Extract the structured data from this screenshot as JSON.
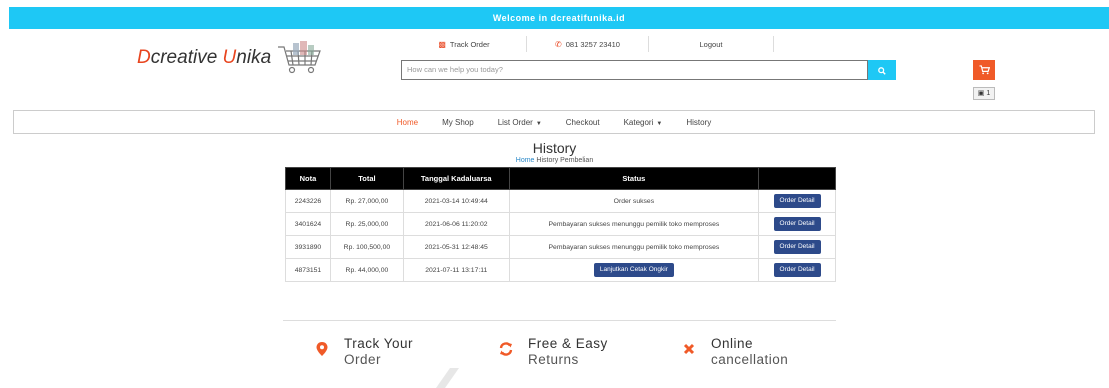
{
  "topbar": {
    "welcome": "Welcome in dcreatifunika.id"
  },
  "logo": {
    "d": "D",
    "creative": "creative ",
    "u": "U",
    "nika": "nika",
    "icon": "shopping-cart-image"
  },
  "toplinks": {
    "track": "Track Order",
    "phone": "081 3257 23410",
    "logout": "Logout"
  },
  "search": {
    "placeholder": "How can we help you today?",
    "icon": "search-icon"
  },
  "cart": {
    "icon": "cart-icon",
    "bag_count": "1"
  },
  "nav": {
    "home": "Home",
    "shop": "My Shop",
    "list_order": "List Order",
    "checkout": "Checkout",
    "kategori": "Kategori",
    "history": "History"
  },
  "page": {
    "title": "History",
    "crumb_home": "Home",
    "crumb_rest": " History Pembelian"
  },
  "table": {
    "headers": [
      "Nota",
      "Total",
      "Tanggal Kadaluarsa",
      "Status",
      ""
    ],
    "rows": [
      {
        "nota": "2243226",
        "total": "Rp. 27,000,00",
        "tanggal": "2021-03-14 10:49:44",
        "status": "Order sukses",
        "status_is_button": false,
        "action": "Order Detail"
      },
      {
        "nota": "3401624",
        "total": "Rp. 25,000,00",
        "tanggal": "2021-06-06 11:20:02",
        "status": "Pembayaran sukses menunggu pemilik toko memproses",
        "status_is_button": false,
        "action": "Order Detail"
      },
      {
        "nota": "3931890",
        "total": "Rp. 100,500,00",
        "tanggal": "2021-05-31 12:48:45",
        "status": "Pembayaran sukses menunggu pemilik toko memproses",
        "status_is_button": false,
        "action": "Order Detail"
      },
      {
        "nota": "4873151",
        "total": "Rp. 44,000,00",
        "tanggal": "2021-07-11 13:17:11",
        "status": "Lanjutkan Cetak Ongkir",
        "status_is_button": true,
        "action": "Order Detail"
      }
    ]
  },
  "features": [
    {
      "icon": "map-pin-icon",
      "line1": "Track Your",
      "line2": "Order"
    },
    {
      "icon": "refresh-icon",
      "line1": "Free & Easy",
      "line2": "Returns"
    },
    {
      "icon": "close-icon",
      "line1": "Online",
      "line2": "cancellation"
    }
  ],
  "colors": {
    "accent": "#1ec8f5",
    "orange": "#f05a28",
    "button": "#2d4a8a"
  }
}
